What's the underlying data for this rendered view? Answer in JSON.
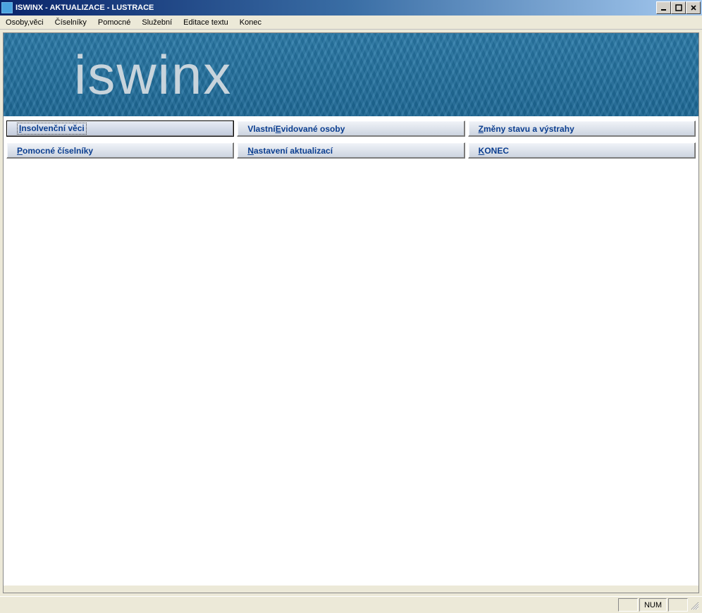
{
  "window": {
    "title": "ISWINX - AKTUALIZACE - LUSTRACE"
  },
  "menubar": {
    "items": [
      {
        "label": "Osoby,věci",
        "hotkey_index": 0
      },
      {
        "label": "Číselníky",
        "hotkey_index": 0
      },
      {
        "label": "Pomocné",
        "hotkey_index": 0
      },
      {
        "label": "Služební",
        "hotkey_index": 0
      },
      {
        "label": "Editace textu",
        "hotkey_index": 0
      },
      {
        "label": "Konec",
        "hotkey_index": 0
      }
    ]
  },
  "banner": {
    "text": "iswinx"
  },
  "buttons": {
    "row1": [
      {
        "label": "Insolvenční věci",
        "hotkey_index": 0,
        "focused": true
      },
      {
        "label": "Vlastní Evidované osoby",
        "hotkey_index": 8,
        "focused": false
      },
      {
        "label": "Změny stavu a výstrahy",
        "hotkey_index": 0,
        "focused": false
      }
    ],
    "row2": [
      {
        "label": "Pomocné číselníky",
        "hotkey_index": 0,
        "focused": false
      },
      {
        "label": "Nastavení aktualizací",
        "hotkey_index": 0,
        "focused": false
      },
      {
        "label": "KONEC",
        "hotkey_index": 0,
        "focused": false
      }
    ]
  },
  "statusbar": {
    "indicator": "NUM"
  }
}
